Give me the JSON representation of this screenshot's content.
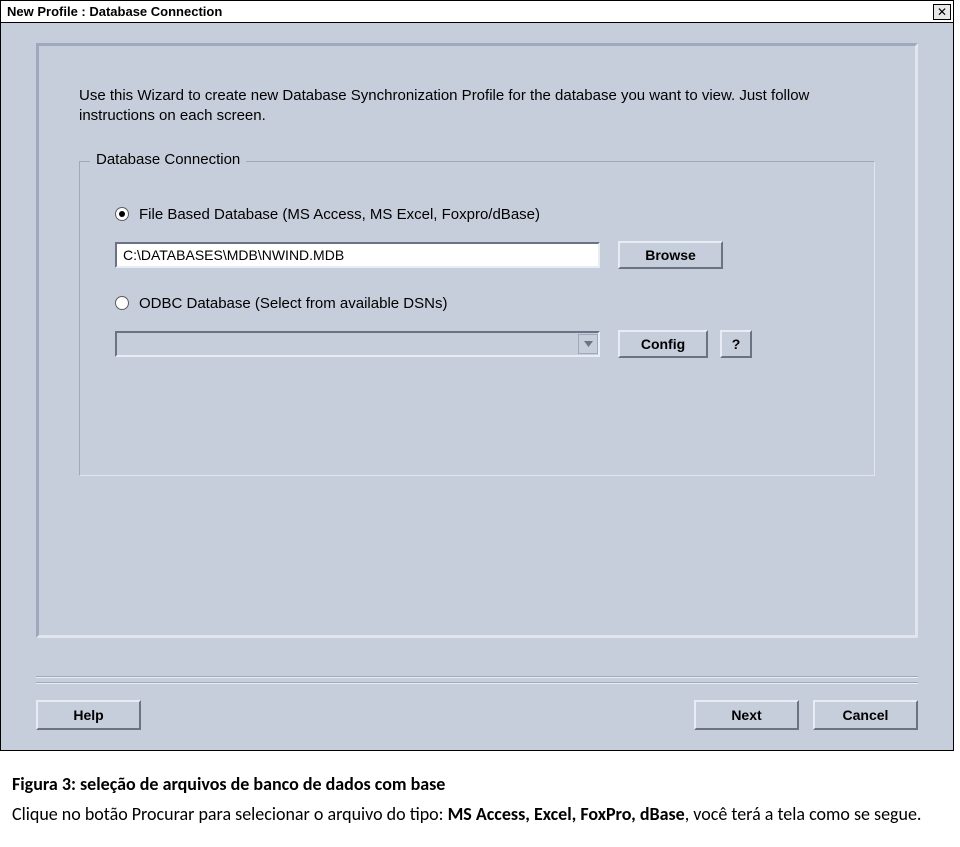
{
  "window": {
    "title": "New Profile : Database Connection",
    "close_glyph": "✕"
  },
  "wizard": {
    "intro": "Use this Wizard to create new Database Synchronization Profile for the database you want to view. Just follow instructions on each screen."
  },
  "group": {
    "title": "Database Connection",
    "file_radio_label": "File Based Database (MS Access, MS Excel, Foxpro/dBase)",
    "file_path_value": "C:\\DATABASES\\MDB\\NWIND.MDB",
    "browse_label": "Browse",
    "odbc_radio_label": "ODBC Database (Select from available DSNs)",
    "config_label": "Config",
    "help_q_label": "?"
  },
  "footer": {
    "help_label": "Help",
    "next_label": "Next",
    "cancel_label": "Cancel"
  },
  "caption": {
    "title": "Figura 3: seleção de arquivos de banco de dados com base",
    "line_prefix": "Clique no botão Procurar para selecionar o arquivo do tipo: ",
    "strong": "MS Access, Excel, FoxPro, dBase",
    "line_suffix": ", você terá a tela como se segue."
  }
}
